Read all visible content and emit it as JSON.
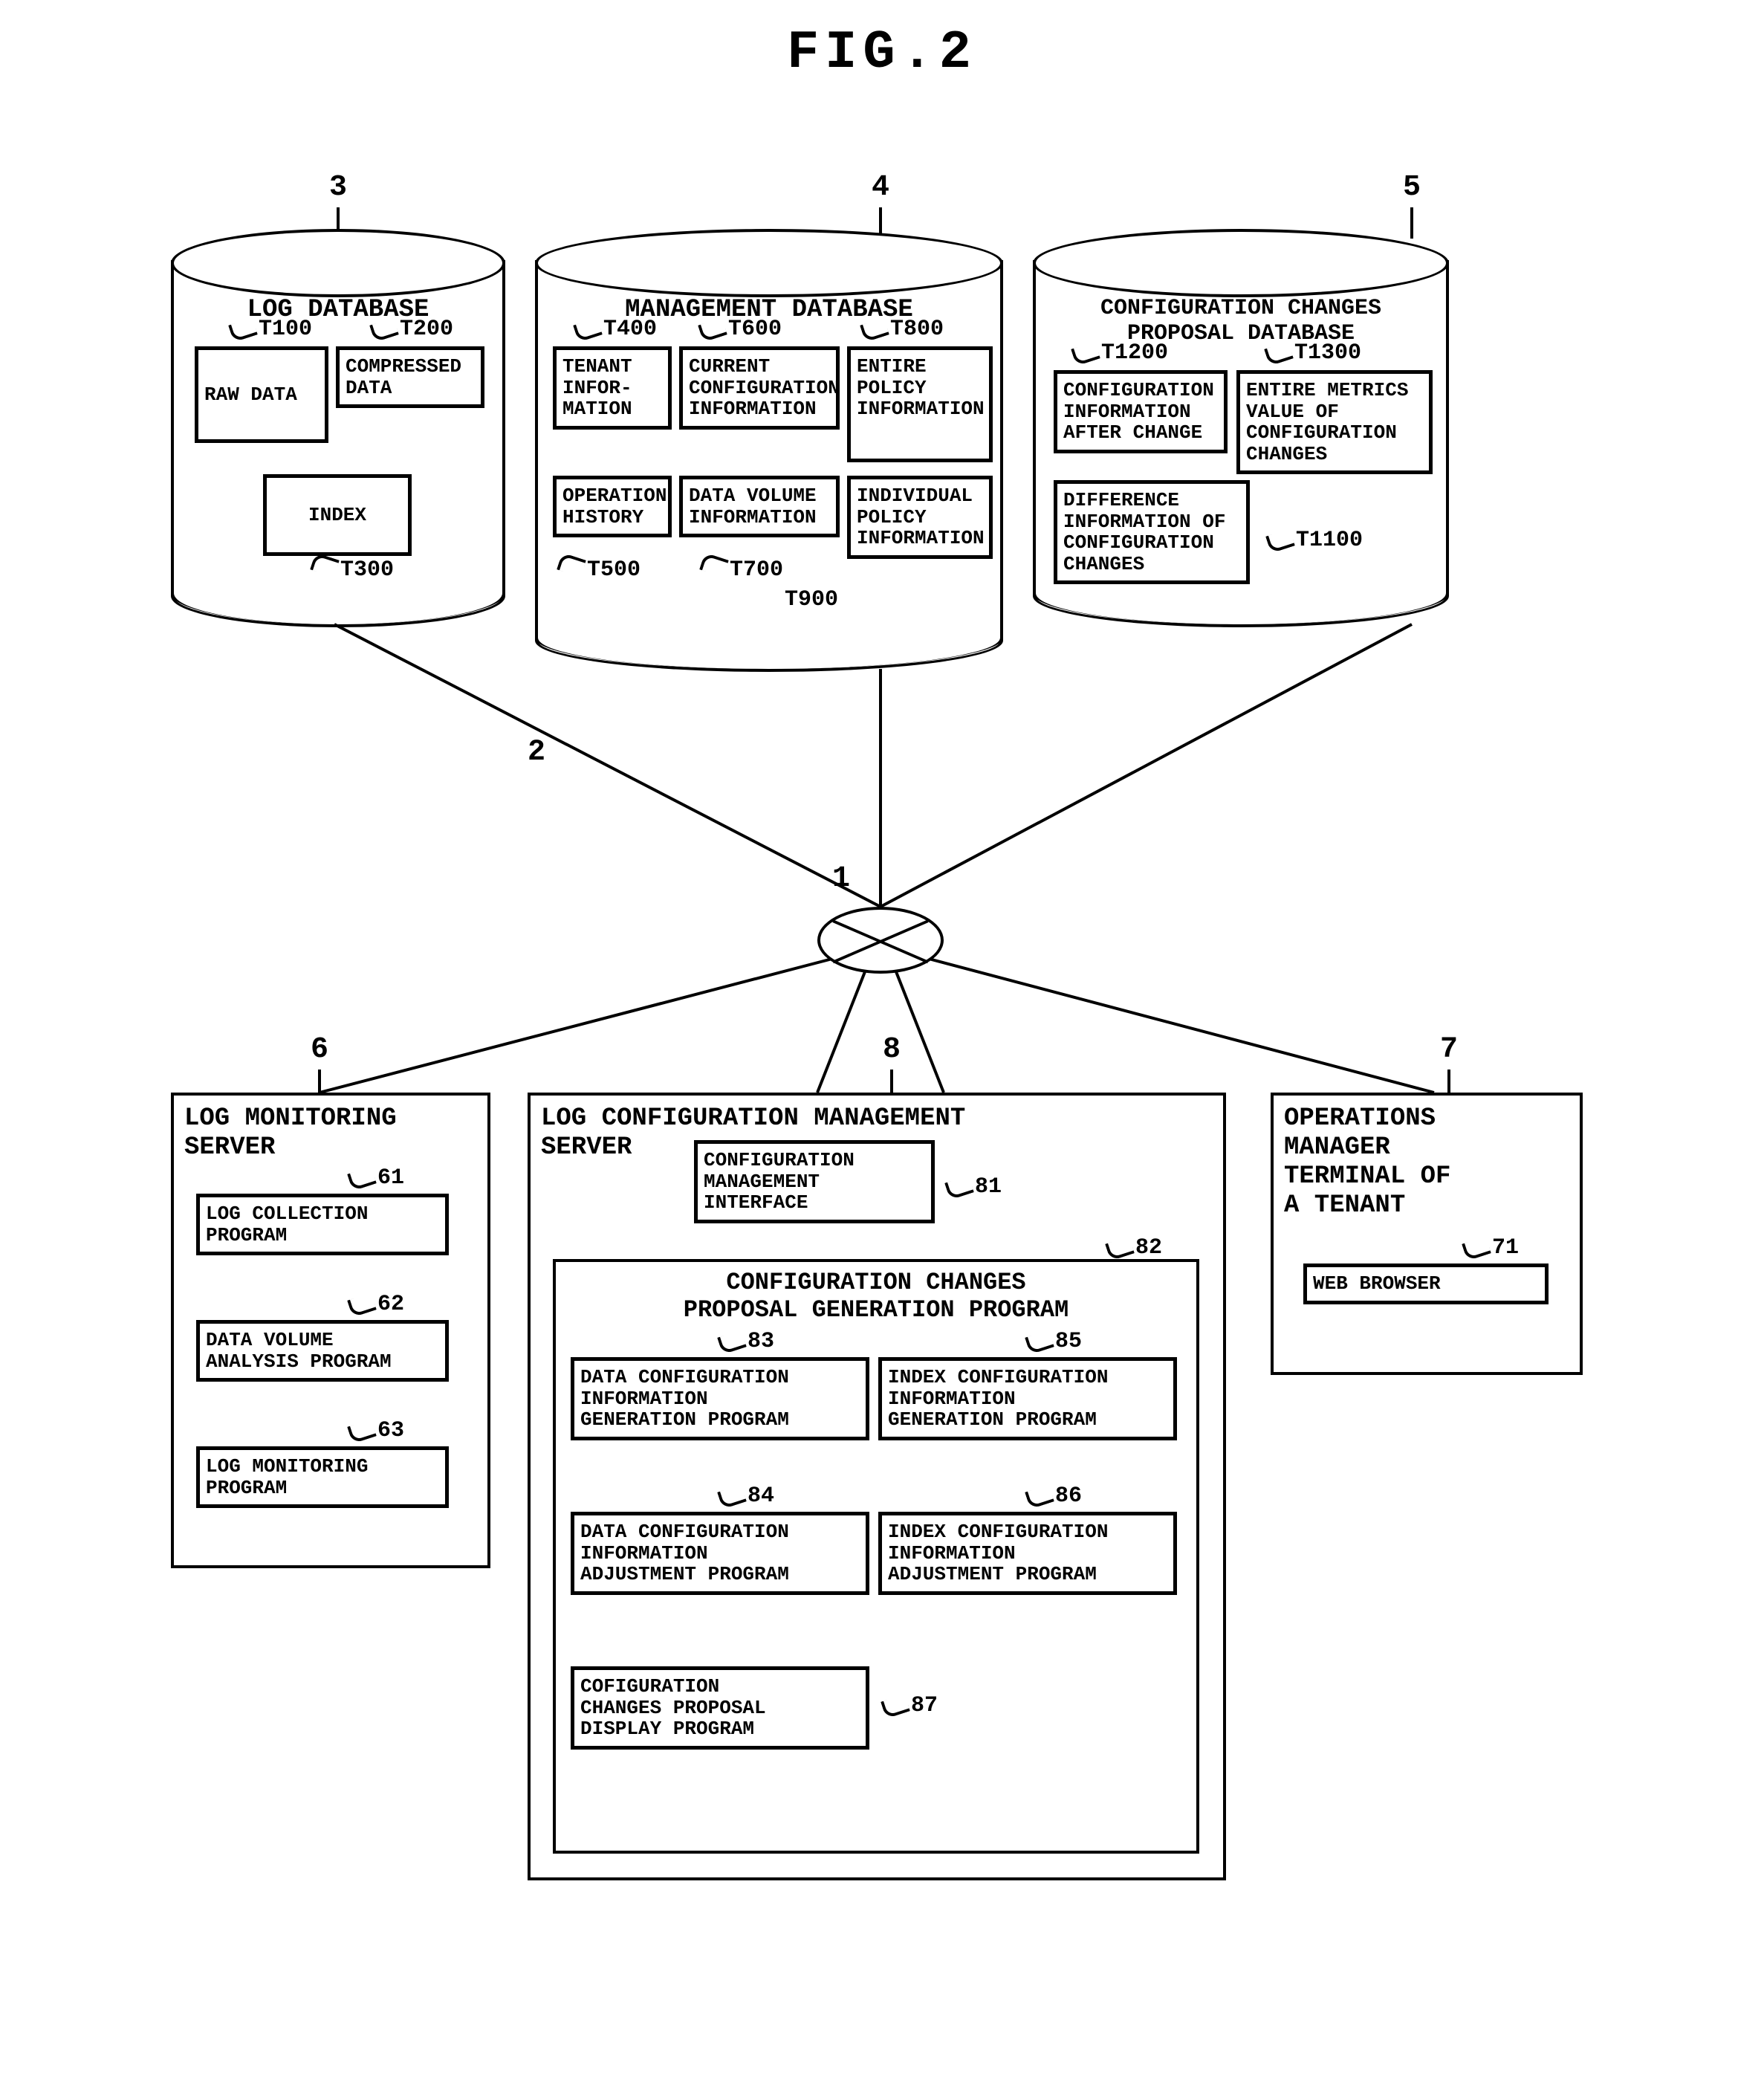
{
  "figure_title": "FIG.2",
  "refs": {
    "db_log": "3",
    "db_mgmt": "4",
    "db_prop": "5",
    "net_upper": "2",
    "hub": "1",
    "srv_log": "6",
    "srv_cfg": "8",
    "term": "7"
  },
  "db_log": {
    "title": "LOG DATABASE",
    "items": {
      "raw": "RAW DATA",
      "comp": "COMPRESSED\nDATA",
      "idx": "INDEX"
    },
    "item_refs": {
      "raw": "T100",
      "comp": "T200",
      "idx": "T300"
    }
  },
  "db_mgmt": {
    "title": "MANAGEMENT DATABASE",
    "items": {
      "tenant": "TENANT\nINFOR-\nMATION",
      "curcfg": "CURRENT\nCONFIGURATION\nINFORMATION",
      "entpol": "ENTIRE\nPOLICY\nINFORMATION",
      "ophist": "OPERATION\nHISTORY",
      "dvol": "DATA VOLUME\nINFORMATION",
      "indpol": "INDIVIDUAL\nPOLICY\nINFORMATION"
    },
    "item_refs": {
      "tenant": "T400",
      "curcfg": "T600",
      "entpol": "T800",
      "ophist": "T500",
      "dvol": "T700",
      "indpol": "T900"
    }
  },
  "db_prop": {
    "title": "CONFIGURATION CHANGES\nPROPOSAL DATABASE",
    "items": {
      "after": "CONFIGURATION\nINFORMATION\nAFTER CHANGE",
      "metrics": "ENTIRE METRICS\nVALUE OF\nCONFIGURATION\nCHANGES",
      "diff": "DIFFERENCE\nINFORMATION OF\nCONFIGURATION\nCHANGES"
    },
    "item_refs": {
      "after": "T1200",
      "metrics": "T1300",
      "diff": "T1100"
    }
  },
  "srv_log": {
    "title": "LOG MONITORING\nSERVER",
    "progs": {
      "collect": "LOG COLLECTION\nPROGRAM",
      "dvol": "DATA VOLUME\nANALYSIS PROGRAM",
      "mon": "LOG MONITORING\nPROGRAM"
    },
    "prog_refs": {
      "collect": "61",
      "dvol": "62",
      "mon": "63"
    }
  },
  "srv_cfg": {
    "title": "LOG CONFIGURATION MANAGEMENT\nSERVER",
    "iface": "CONFIGURATION\nMANAGEMENT\nINTERFACE",
    "iface_ref": "81",
    "group_title": "CONFIGURATION CHANGES\nPROPOSAL GENERATION PROGRAM",
    "group_ref": "82",
    "progs": {
      "dcgen": "DATA CONFIGURATION\nINFORMATION\nGENERATION PROGRAM",
      "icgen": "INDEX CONFIGURATION\nINFORMATION\nGENERATION PROGRAM",
      "dcadj": "DATA CONFIGURATION\nINFORMATION\nADJUSTMENT PROGRAM",
      "icadj": "INDEX CONFIGURATION\nINFORMATION\nADJUSTMENT PROGRAM",
      "disp": "COFIGURATION\nCHANGES PROPOSAL\nDISPLAY PROGRAM"
    },
    "prog_refs": {
      "dcgen": "83",
      "icgen": "85",
      "dcadj": "84",
      "icadj": "86",
      "disp": "87"
    }
  },
  "term": {
    "title": "OPERATIONS\nMANAGER\nTERMINAL OF\nA TENANT",
    "item": "WEB BROWSER",
    "item_ref": "71"
  }
}
